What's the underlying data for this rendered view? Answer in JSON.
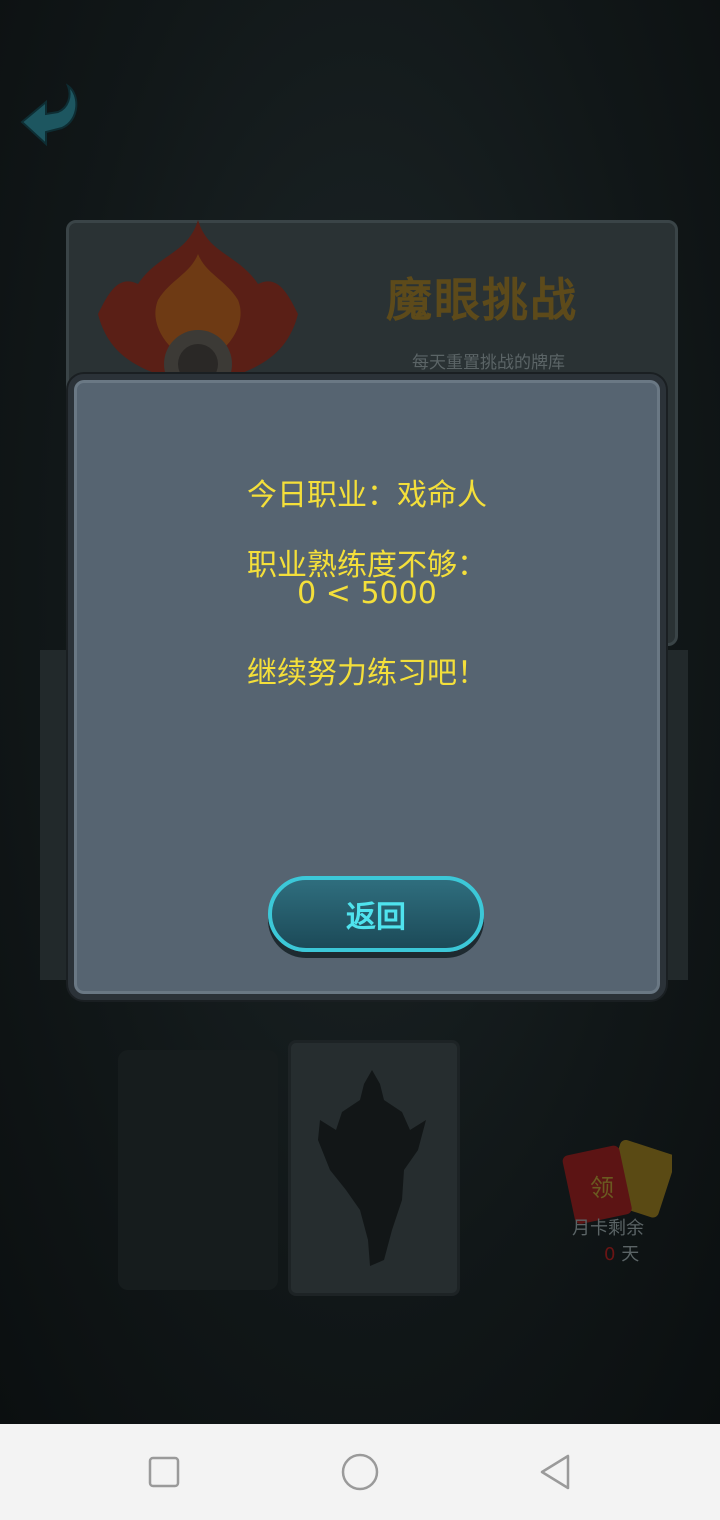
{
  "background": {
    "challenge_title": "魔眼挑战",
    "challenge_subtitle": "每天重置挑战的牌库",
    "month_card_label": "月卡剩余",
    "month_card_days": "0",
    "month_card_unit": "天",
    "redpacket_char": "领"
  },
  "dialog": {
    "today_class": "今日职业：戏命人",
    "proficiency_insufficient": "职业熟练度不够：",
    "proficiency_value": "0 < 5000",
    "encourage": "继续努力练习吧！",
    "return_button": "返回"
  },
  "icons": {
    "back": "back-arrow-icon",
    "nav_recent": "square-icon",
    "nav_home": "circle-icon",
    "nav_back": "triangle-back-icon"
  },
  "colors": {
    "dialog_text": "#f4df3a",
    "button_text": "#4fe3ee",
    "dialog_bg": "#566471"
  }
}
